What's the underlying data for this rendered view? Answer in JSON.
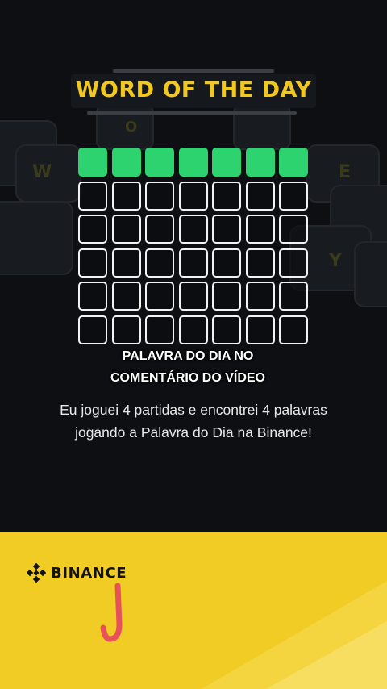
{
  "header": {
    "title": "WORD OF THE DAY"
  },
  "bg_letters": [
    "W",
    "O",
    "E",
    "Y"
  ],
  "grid": {
    "rows": 6,
    "columns": 7,
    "rows_filled": [
      true,
      false,
      false,
      false,
      false,
      false
    ],
    "filled_color": "#2dd36f",
    "empty_border_color": "#f2f2f2"
  },
  "caption": "PALAVRA DO DIA NO COMENTÁRIO DO VÍDEO",
  "description": "Eu joguei 4 partidas e encontrei 4 palavras jogando a Palavra do Dia na Binance!",
  "footer": {
    "brand": "BINANCE",
    "brand_icon": "binance-logo-icon",
    "user_icon": "letter-j-mark",
    "background_color": "#f1cc24",
    "user_mark_color": "#e8505b"
  },
  "colors": {
    "title": "#f3c81e",
    "background": "#0d0f12"
  }
}
